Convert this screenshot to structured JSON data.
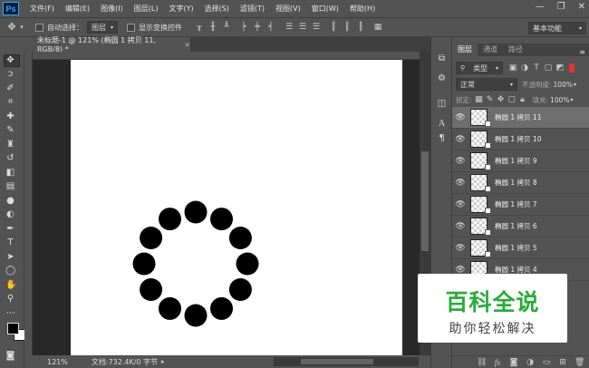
{
  "menu": {
    "logo": "Ps",
    "items": [
      "文件(F)",
      "编辑(E)",
      "图像(I)",
      "图层(L)",
      "文字(Y)",
      "选择(S)",
      "滤镜(T)",
      "视图(V)",
      "窗口(W)",
      "帮助(H)"
    ],
    "window_controls": [
      "—",
      "❐",
      "✕"
    ]
  },
  "options_bar": {
    "auto_select_label": "自动选择：",
    "auto_select_value": "图层",
    "show_transform_label": "显示变换控件",
    "workspace": "基本功能"
  },
  "document": {
    "tab_title": "未标题-1 @ 121% (椭圆 1 拷贝 11, RGB/8) *",
    "zoom": "121%",
    "doc_info": "文档:732.4K/0 字节"
  },
  "panels": {
    "tabs": [
      "图层",
      "通道",
      "路径"
    ],
    "filter_kind": "类型",
    "blend_mode": "正常",
    "opacity_label": "不透明度:",
    "opacity_value": "100%",
    "lock_label": "锁定:",
    "fill_label": "填充:",
    "fill_value": "100%"
  },
  "layers": [
    {
      "name": "椭圆 1 拷贝 11",
      "selected": true
    },
    {
      "name": "椭圆 1 拷贝 10",
      "selected": false
    },
    {
      "name": "椭圆 1 拷贝 9",
      "selected": false
    },
    {
      "name": "椭圆 1 拷贝 8",
      "selected": false
    },
    {
      "name": "椭圆 1 拷贝 7",
      "selected": false
    },
    {
      "name": "椭圆 1 拷贝 6",
      "selected": false
    },
    {
      "name": "椭圆 1 拷贝 5",
      "selected": false
    },
    {
      "name": "椭圆 1 拷贝 4",
      "selected": false
    }
  ],
  "watermark": {
    "title": "百科全说",
    "subtitle": "助你轻松解决"
  },
  "colors": {
    "ui_bg": "#535353",
    "workspace": "#282828",
    "canvas": "#ffffff",
    "selected_layer": "#6e6e6e",
    "watermark_green": "#2bab3a"
  }
}
